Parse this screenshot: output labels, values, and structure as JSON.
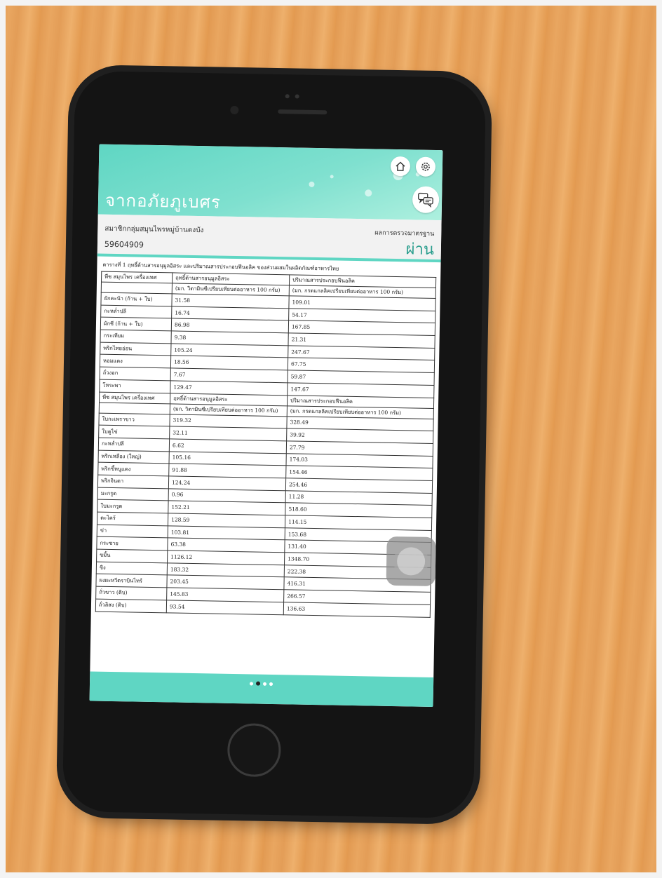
{
  "app": {
    "title": "จากอภัยภูเบศร"
  },
  "member": {
    "label": "สมาชิกกลุ่มสมุนไพรหมู่บ้านดงบัง",
    "id": "59604909"
  },
  "status": {
    "label": "ผลการตรวจมาตรฐาน",
    "value": "ผ่าน"
  },
  "document": {
    "caption": "ตารางที่ 1 ฤทธิ์ต้านสารอนุมูลอิสระ และปริมาณสารประกอบฟีนอลิค ของส่วนผสมในผลิตภัณฑ์อาหารไทย",
    "columns": [
      "พืช สมุนไพร เครื่องเทศ",
      "ฤทธิ์ต้านสารอนุมูลอิสระ",
      "ปริมาณสารประกอบฟีนอลิค"
    ],
    "units": [
      "",
      "(มก. วิตามินซีเปรียบเทียบต่ออาหาร 100 กรัม)",
      "(มก. กรดแกลลิคเปรียบเทียบต่ออาหาร 100 กรัม)"
    ],
    "rows": [
      [
        "ผักคะน้า (ก้าน + ใบ)",
        "31.58",
        "109.01"
      ],
      [
        "กะหล่ำปลี",
        "16.74",
        "54.17"
      ],
      [
        "ผักชี (ก้าน + ใบ)",
        "86.98",
        "167.85"
      ],
      [
        "กระเทียม",
        "9.38",
        "21.31"
      ],
      [
        "พริกไทยอ่อน",
        "105.24",
        "247.67"
      ],
      [
        "หอมแดง",
        "18.56",
        "67.75"
      ],
      [
        "ถั่วงอก",
        "7.67",
        "59.87"
      ],
      [
        "โหระพา",
        "129.47",
        "147.67"
      ]
    ],
    "rows2": [
      [
        "ใบกะเพราขาว",
        "319.32",
        "328.49"
      ],
      [
        "ใบคูไข่",
        "32.11",
        "39.92"
      ],
      [
        "กะหล่ำปลี",
        "6.62",
        "27.79"
      ],
      [
        "พริกเหลือง (ใหญ่)",
        "105.16",
        "174.03"
      ],
      [
        "พริกขี้หนูแดง",
        "91.88",
        "154.46"
      ],
      [
        "พริกจินดา",
        "124.24",
        "254.46"
      ],
      [
        "มะกรูด",
        "0.96",
        "11.28"
      ],
      [
        "ใบมะกรูด",
        "152.21",
        "518.60"
      ],
      [
        "ตะไคร้",
        "128.59",
        "114.15"
      ],
      [
        "ข่า",
        "103.81",
        "153.68"
      ],
      [
        "กระชาย",
        "63.38",
        "131.40"
      ],
      [
        "ขมิ้น",
        "1126.12",
        "1348.70"
      ],
      [
        "ขิง",
        "183.32",
        "222.38"
      ],
      [
        "ผงผะหวีตราบินไทร์",
        "203.45",
        "416.31"
      ],
      [
        "ถั่วขาว (ดิบ)",
        "145.83",
        "266.57"
      ],
      [
        "ถั่วลิสง (ดิบ)",
        "93.54",
        "136.63"
      ]
    ]
  },
  "pager": {
    "count": 4,
    "active": 1
  },
  "icons": {
    "home": "home-icon",
    "settings": "gear-icon",
    "chat": "chat-icon"
  },
  "colors": {
    "accent": "#5fd6c3",
    "pass": "#2b9e8e"
  }
}
